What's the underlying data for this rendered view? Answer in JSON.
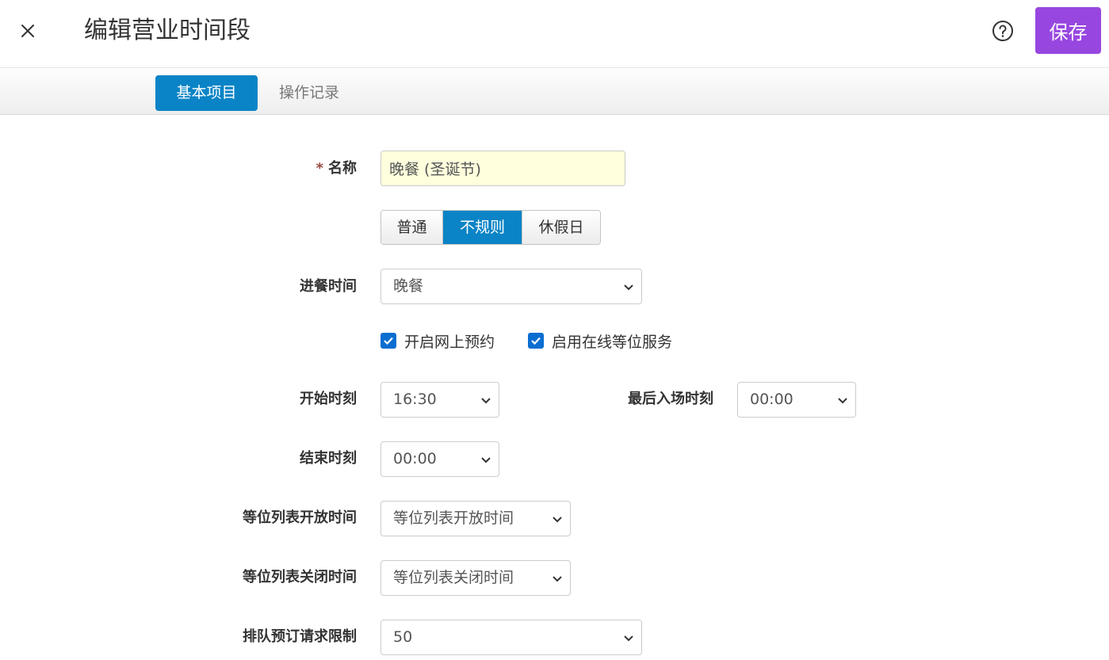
{
  "header": {
    "title": "编辑营业时间段",
    "save_label": "保存",
    "close_icon": "close-icon",
    "help_icon": "help-circle-icon"
  },
  "tabs": [
    {
      "label": "基本项目",
      "active": true
    },
    {
      "label": "操作记录",
      "active": false
    }
  ],
  "form": {
    "name": {
      "required_mark": "*",
      "label": "名称",
      "value": "晚餐 (圣诞节)"
    },
    "type_options": [
      {
        "label": "普通",
        "selected": false
      },
      {
        "label": "不规则",
        "selected": true
      },
      {
        "label": "休假日",
        "selected": false
      }
    ],
    "meal_time": {
      "label": "进餐时间",
      "value": "晚餐"
    },
    "checkboxes": [
      {
        "label": "开启网上预约",
        "checked": true
      },
      {
        "label": "启用在线等位服务",
        "checked": true
      }
    ],
    "start_time": {
      "label": "开始时刻",
      "value": "16:30"
    },
    "last_entry": {
      "label": "最后入场时刻",
      "value": "00:00"
    },
    "end_time": {
      "label": "结束时刻",
      "value": "00:00"
    },
    "waitlist_open": {
      "label": "等位列表开放时间",
      "value": "等位列表开放时间"
    },
    "waitlist_close": {
      "label": "等位列表关闭时间",
      "value": "等位列表关闭时间"
    },
    "queue_limit": {
      "label": "排队预订请求限制",
      "value": "50"
    }
  },
  "colors": {
    "accent_blue": "#0a84c6",
    "save_purple": "#9747e0",
    "name_bg": "#ffffdd",
    "required_red": "#9b4a3f"
  }
}
